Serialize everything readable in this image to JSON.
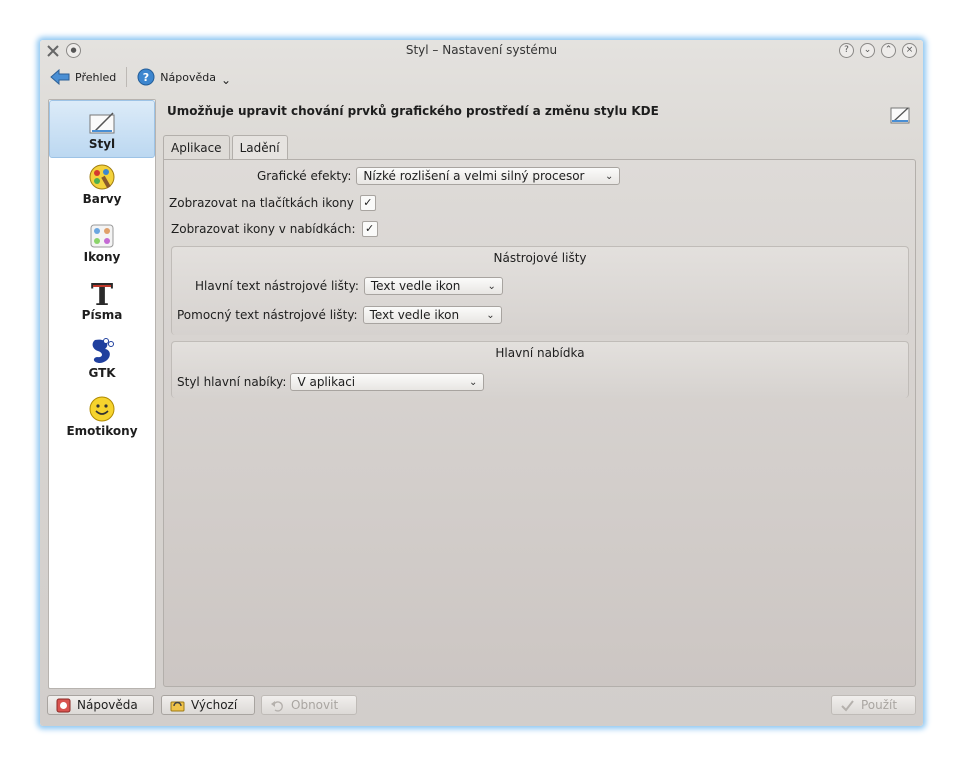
{
  "window": {
    "title": "Styl – Nastavení systému"
  },
  "title_buttons": [
    "?",
    "⌄",
    "⌃",
    "×"
  ],
  "toolbar": {
    "overview_label": "Přehled",
    "help_label": "Nápověda",
    "help_menu_arrow": "⌄"
  },
  "sidebar": {
    "items": [
      {
        "label": "Styl",
        "icon": "style-icon",
        "selected": true
      },
      {
        "label": "Barvy",
        "icon": "colors-icon"
      },
      {
        "label": "Ikony",
        "icon": "icons-icon"
      },
      {
        "label": "Písma",
        "icon": "fonts-icon"
      },
      {
        "label": "GTK",
        "icon": "gtk-icon"
      },
      {
        "label": "Emotikony",
        "icon": "emoticons-icon"
      }
    ]
  },
  "content": {
    "description": "Umožňuje upravit chování prvků grafického prostředí a změnu stylu KDE",
    "tabs": [
      {
        "label": "Aplikace",
        "active": false
      },
      {
        "label": "Ladění",
        "active": true
      }
    ],
    "graphic_effects_label": "Grafické efekty:",
    "graphic_effects_value": "Nízké rozlišení a velmi silný procesor",
    "show_button_icons_label": "Zobrazovat na tlačítkách ikony",
    "show_button_icons_checked": "✓",
    "show_menu_icons_label": "Zobrazovat ikony v nabídkách:",
    "show_menu_icons_checked": "✓",
    "toolbars_group": {
      "title": "Nástrojové lišty",
      "main_text_label": "Hlavní text nástrojové lišty:",
      "main_text_value": "Text vedle ikon",
      "secondary_text_label": "Pomocný text nástrojové lišty:",
      "secondary_text_value": "Text vedle ikon"
    },
    "menubar_group": {
      "title": "Hlavní nabídka",
      "style_label": "Styl hlavní nabíky:",
      "style_value": "V aplikaci"
    }
  },
  "footer": {
    "help_label": "Nápověda",
    "defaults_label": "Výchozí",
    "reset_label": "Obnovit",
    "apply_label": "Použít"
  },
  "colors": {
    "selection": "#bcd8f1",
    "window_glow": "#8fc7f2",
    "disabled_text": "#a9a5a1"
  }
}
